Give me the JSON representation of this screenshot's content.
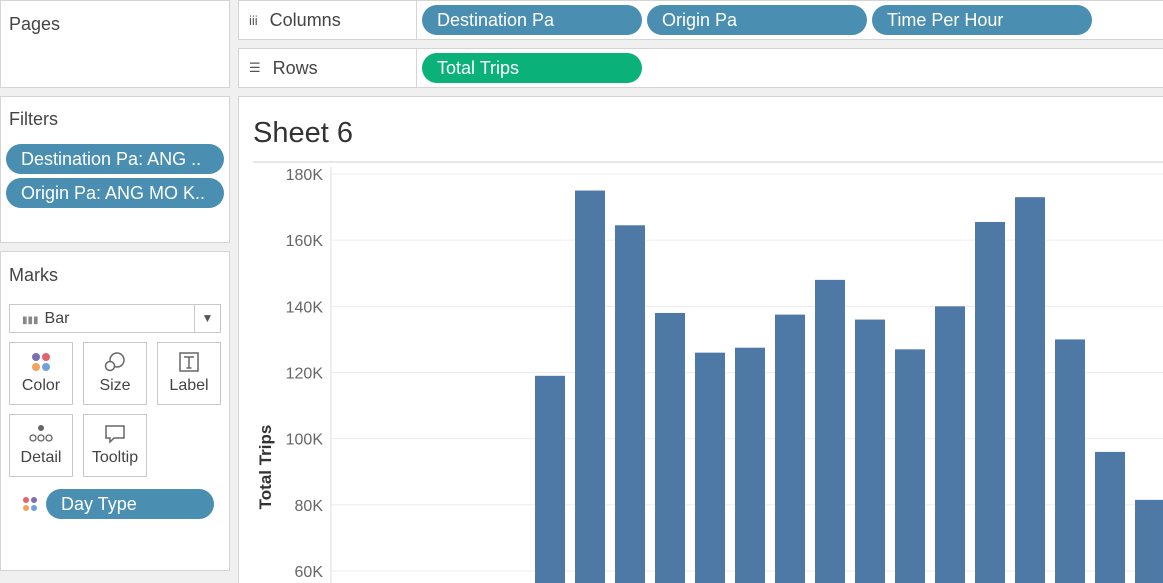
{
  "pages": {
    "title": "Pages"
  },
  "filters": {
    "title": "Filters",
    "items": [
      "Destination Pa: ANG ..",
      "Origin Pa: ANG MO K.."
    ]
  },
  "marks": {
    "title": "Marks",
    "type": "Bar",
    "buttons": {
      "color": "Color",
      "size": "Size",
      "label": "Label",
      "detail": "Detail",
      "tooltip": "Tooltip"
    },
    "color_field": "Day Type"
  },
  "columns": {
    "label": "Columns",
    "pills": [
      "Destination Pa",
      "Origin Pa",
      "Time Per Hour"
    ]
  },
  "rows": {
    "label": "Rows",
    "pills": [
      "Total Trips"
    ]
  },
  "sheet": {
    "title": "Sheet 6"
  },
  "colors": {
    "dimension_pill": "#4a8fb2",
    "measure_pill": "#0ab27a",
    "bar": "#4e79a7"
  },
  "chart_data": {
    "type": "bar",
    "ylabel": "Total Trips",
    "ylim": [
      60000,
      180000
    ],
    "yticks": [
      60000,
      80000,
      100000,
      120000,
      140000,
      160000,
      180000
    ],
    "ytick_labels": [
      "60K",
      "80K",
      "100K",
      "120K",
      "140K",
      "160K",
      "180K"
    ],
    "grid": true,
    "values": [
      0,
      0,
      0,
      0,
      0,
      119000,
      175000,
      164500,
      138000,
      126000,
      127500,
      137500,
      148000,
      136000,
      127000,
      140000,
      165500,
      173000,
      130000,
      96000,
      81500
    ]
  }
}
